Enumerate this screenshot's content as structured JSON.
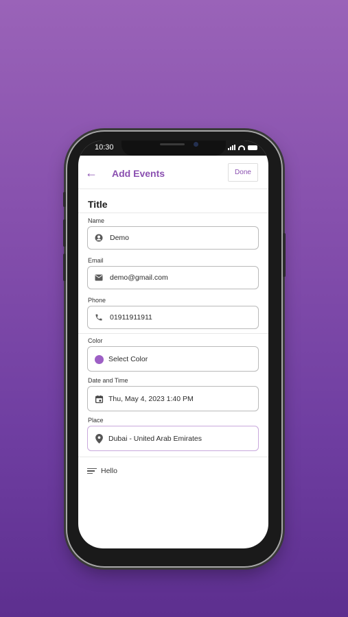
{
  "status": {
    "time": "10:30"
  },
  "header": {
    "title": "Add Events",
    "done_label": "Done"
  },
  "section_title": "Title",
  "fields": {
    "name": {
      "label": "Name",
      "value": "Demo",
      "icon": "person-icon"
    },
    "email": {
      "label": "Email",
      "value": "demo@gmail.com",
      "icon": "mail-icon"
    },
    "phone": {
      "label": "Phone",
      "value": "01911911911",
      "icon": "phone-icon"
    },
    "color": {
      "label": "Color",
      "value": "Select Color",
      "icon": "color-dot",
      "swatch": "#9d5fc5"
    },
    "datetime": {
      "label": "Date and Time",
      "value": "Thu, May 4, 2023 1:40 PM",
      "icon": "calendar-icon"
    },
    "place": {
      "label": "Place",
      "value": "Dubai - United Arab Emirates",
      "icon": "location-pin-icon"
    }
  },
  "notes": {
    "value": "Hello",
    "icon": "notes-icon"
  },
  "colors": {
    "accent": "#8a4fb0",
    "background_top": "#9a63b8",
    "background_bottom": "#5d2f8f"
  }
}
